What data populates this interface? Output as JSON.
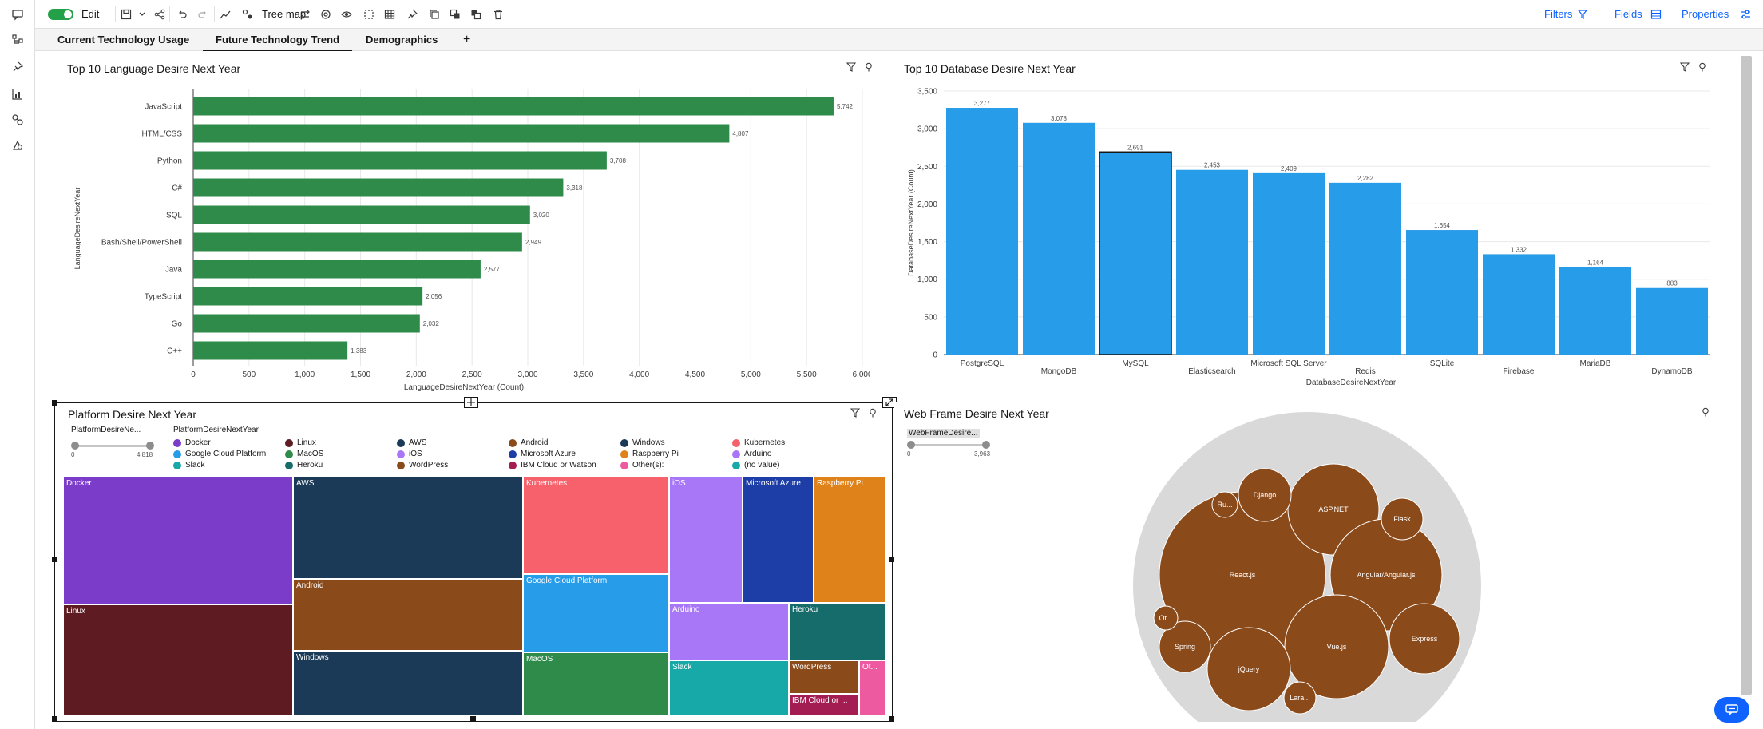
{
  "toolbar": {
    "edit_label": "Edit",
    "visualization_label": "Tree map",
    "filters_label": "Filters",
    "fields_label": "Fields",
    "properties_label": "Properties"
  },
  "tabs": [
    {
      "label": "Current Technology Usage"
    },
    {
      "label": "Future Technology Trend"
    },
    {
      "label": "Demographics"
    }
  ],
  "tab_add_label": "+",
  "panels": {
    "language": {
      "title": "Top 10 Language Desire Next Year",
      "ylabel": "LanguageDesireNextYear",
      "xlabel": "LanguageDesireNextYear (Count)"
    },
    "database": {
      "title": "Top 10 Database Desire Next Year",
      "ylabel": "DatabaseDesireNextYear (Count)",
      "xlabel": "DatabaseDesireNextYear"
    },
    "platform": {
      "title": "Platform Desire Next Year",
      "slider_label": "PlatformDesireNe...",
      "slider_min": "0",
      "slider_max": "4,818",
      "legend_title": "PlatformDesireNextYear"
    },
    "webframe": {
      "title": "Web Frame Desire Next Year",
      "slider_label": "WebFrameDesire...",
      "slider_min": "0",
      "slider_max": "3,963"
    }
  },
  "chart_data": [
    {
      "type": "bar",
      "orientation": "horizontal",
      "title": "Top 10 Language Desire Next Year",
      "categories": [
        "JavaScript",
        "HTML/CSS",
        "Python",
        "C#",
        "SQL",
        "Bash/Shell/PowerShell",
        "Java",
        "TypeScript",
        "Go",
        "C++"
      ],
      "values": [
        5742,
        4807,
        3708,
        3318,
        3020,
        2949,
        2577,
        2056,
        2032,
        1383
      ],
      "labels": [
        "5,742",
        "4,807",
        "3,708",
        "3,318",
        "3,020",
        "2,949",
        "2,577",
        "2,056",
        "2,032",
        "1,383"
      ],
      "xlim": [
        0,
        6000
      ],
      "ticks": [
        "0",
        "500",
        "1,000",
        "1,500",
        "2,000",
        "2,500",
        "3,000",
        "3,500",
        "4,000",
        "4,500",
        "5,000",
        "5,500",
        "6,000"
      ],
      "color": "#2e8b4a"
    },
    {
      "type": "bar",
      "orientation": "vertical",
      "title": "Top 10 Database Desire Next Year",
      "categories": [
        "PostgreSQL",
        "MongoDB",
        "MySQL",
        "Elasticsearch",
        "Microsoft SQL Server",
        "Redis",
        "SQLite",
        "Firebase",
        "MariaDB",
        "DynamoDB"
      ],
      "values": [
        3277,
        3078,
        2691,
        2453,
        2409,
        2282,
        1654,
        1332,
        1164,
        883
      ],
      "labels": [
        "3,277",
        "3,078",
        "2,691",
        "2,453",
        "2,409",
        "2,282",
        "1,654",
        "1,332",
        "1,164",
        "883"
      ],
      "ylim": [
        0,
        3500
      ],
      "ticks": [
        "0",
        "500",
        "1,000",
        "1,500",
        "2,000",
        "2,500",
        "3,000",
        "3,500"
      ],
      "color": "#279ce8"
    }
  ],
  "legend": [
    {
      "label": "Docker",
      "color": "#7b3cc9"
    },
    {
      "label": "Linux",
      "color": "#5e1c22"
    },
    {
      "label": "AWS",
      "color": "#1b3a57"
    },
    {
      "label": "Android",
      "color": "#8b4a1a"
    },
    {
      "label": "Windows",
      "color": "#1b3a57"
    },
    {
      "label": "Kubernetes",
      "color": "#f6616b"
    },
    {
      "label": "Google Cloud Platform",
      "color": "#279ce8"
    },
    {
      "label": "MacOS",
      "color": "#2e8b4a"
    },
    {
      "label": "iOS",
      "color": "#a877f7"
    },
    {
      "label": "Microsoft Azure",
      "color": "#1d3ea6"
    },
    {
      "label": "Raspberry Pi",
      "color": "#e0821a"
    },
    {
      "label": "Arduino",
      "color": "#a877f7"
    },
    {
      "label": "Slack",
      "color": "#17a8a8"
    },
    {
      "label": "Heroku",
      "color": "#166b6b"
    },
    {
      "label": "WordPress",
      "color": "#8b4a1a"
    },
    {
      "label": "IBM Cloud or Watson",
      "color": "#a31d52"
    },
    {
      "label": "Other(s):",
      "color": "#ee5aa0"
    },
    {
      "label": "(no value)",
      "color": "#17a8a8"
    }
  ],
  "treemap": [
    {
      "label": "Docker",
      "color": "#7b3cc9"
    },
    {
      "label": "Linux",
      "color": "#5e1c22"
    },
    {
      "label": "AWS",
      "color": "#1b3a57"
    },
    {
      "label": "Android",
      "color": "#8b4a1a"
    },
    {
      "label": "Windows",
      "color": "#1b3a57"
    },
    {
      "label": "Kubernetes",
      "color": "#f6616b"
    },
    {
      "label": "Google Cloud Platform",
      "color": "#279ce8"
    },
    {
      "label": "MacOS",
      "color": "#2e8b4a"
    },
    {
      "label": "iOS",
      "color": "#a877f7"
    },
    {
      "label": "Microsoft Azure",
      "color": "#1d3ea6"
    },
    {
      "label": "Raspberry Pi",
      "color": "#e0821a"
    },
    {
      "label": "Arduino",
      "color": "#a877f7"
    },
    {
      "label": "Heroku",
      "color": "#166b6b"
    },
    {
      "label": "Slack",
      "color": "#17a8a8"
    },
    {
      "label": "WordPress",
      "color": "#8b4a1a"
    },
    {
      "label": "Ot...",
      "color": "#ee5aa0"
    },
    {
      "label": "IBM Cloud or ...",
      "color": "#a31d52"
    }
  ],
  "bubbles": [
    {
      "label": "React.js"
    },
    {
      "label": "ASP.NET"
    },
    {
      "label": "Angular/Angular.js"
    },
    {
      "label": "Vue.js"
    },
    {
      "label": "jQuery"
    },
    {
      "label": "Express"
    },
    {
      "label": "Django"
    },
    {
      "label": "Flask"
    },
    {
      "label": "Spring"
    },
    {
      "label": "Ru..."
    },
    {
      "label": "Ot..."
    },
    {
      "label": "Lara..."
    }
  ]
}
